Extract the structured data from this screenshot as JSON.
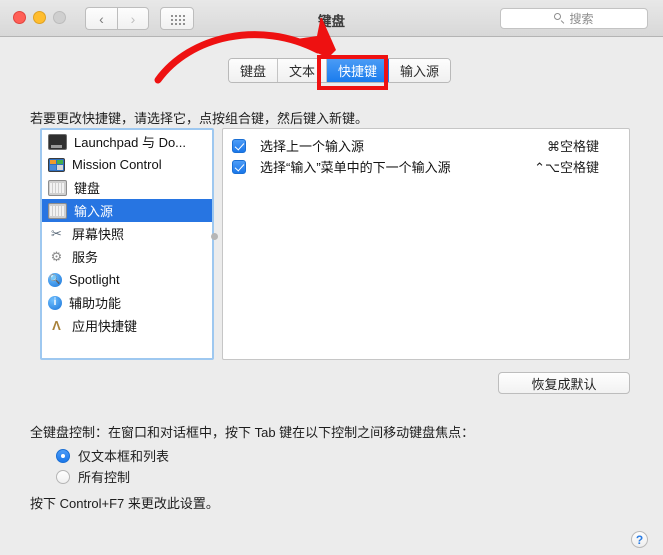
{
  "window": {
    "title": "键盘",
    "traffic_lights": [
      "close",
      "minimize",
      "zoom"
    ],
    "nav": {
      "back": "‹",
      "forward": "›"
    },
    "show_all_icon": "grid-icon"
  },
  "search": {
    "placeholder": "搜索",
    "icon": "search-icon"
  },
  "tabs": [
    {
      "label": "键盘",
      "selected": false
    },
    {
      "label": "文本",
      "selected": false
    },
    {
      "label": "快捷键",
      "selected": true
    },
    {
      "label": "输入源",
      "selected": false
    }
  ],
  "annotation": {
    "highlight_color": "#ee1111",
    "arrow_color": "#ee1111",
    "target_tab": "快捷键"
  },
  "main": {
    "instruction": "若要更改快捷键，请选择它，点按组合键，然后键入新键。",
    "categories": [
      {
        "label": "Launchpad 与 Do...",
        "icon": "launchpad-icon",
        "selected": false
      },
      {
        "label": "Mission Control",
        "icon": "mission-control-icon",
        "selected": false
      },
      {
        "label": "键盘",
        "icon": "keyboard-icon",
        "selected": false
      },
      {
        "label": "输入源",
        "icon": "input-source-icon",
        "selected": true
      },
      {
        "label": "屏幕快照",
        "icon": "screenshot-icon",
        "selected": false
      },
      {
        "label": "服务",
        "icon": "services-gear-icon",
        "selected": false
      },
      {
        "label": "Spotlight",
        "icon": "spotlight-icon",
        "selected": false
      },
      {
        "label": "辅助功能",
        "icon": "accessibility-icon",
        "selected": false
      },
      {
        "label": "应用快捷键",
        "icon": "app-shortcuts-icon",
        "selected": false
      }
    ],
    "shortcuts": [
      {
        "checked": true,
        "name": "选择上一个输入源",
        "key": "⌘空格键"
      },
      {
        "checked": true,
        "name": "选择“输入”菜单中的下一个输入源",
        "key": "⌃⌥空格键"
      }
    ],
    "restore_defaults_label": "恢复成默认",
    "full_keyboard_label": "全键盘控制：在窗口和对话框中，按下 Tab 键在以下控制之间移动键盘焦点：",
    "radio_options": [
      {
        "label": "仅文本框和列表",
        "selected": true
      },
      {
        "label": "所有控制",
        "selected": false
      }
    ],
    "footer_note": "按下 Control+F7 来更改此设置。"
  },
  "help": {
    "label": "?"
  }
}
